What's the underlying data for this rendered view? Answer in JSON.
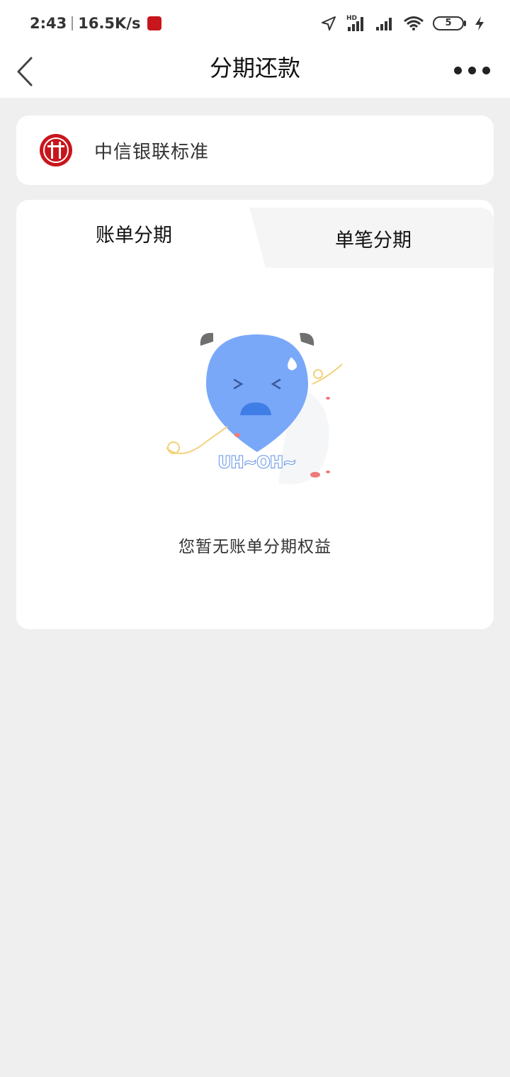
{
  "status_bar": {
    "time": "2:43",
    "network_speed": "16.5K/s",
    "signal_label": "HD",
    "battery_level": "5",
    "icons": [
      "app-badge-icon",
      "location-icon",
      "signal-icon",
      "wifi-icon",
      "battery-icon",
      "charging-icon"
    ]
  },
  "nav": {
    "title": "分期还款",
    "back_icon": "chevron-left-icon",
    "more_icon": "more-dots-icon"
  },
  "card": {
    "name": "中信银联标准",
    "logo_icon": "citic-bank-logo-icon"
  },
  "tabs": [
    {
      "label": "账单分期",
      "active": true
    },
    {
      "label": "单笔分期",
      "active": false
    }
  ],
  "empty_state": {
    "illustration_text": "UH~OH~",
    "message": "您暂无账单分期权益"
  },
  "colors": {
    "brand_red": "#c8161d",
    "mascot_blue": "#7aa8f8",
    "background": "#efefef"
  }
}
